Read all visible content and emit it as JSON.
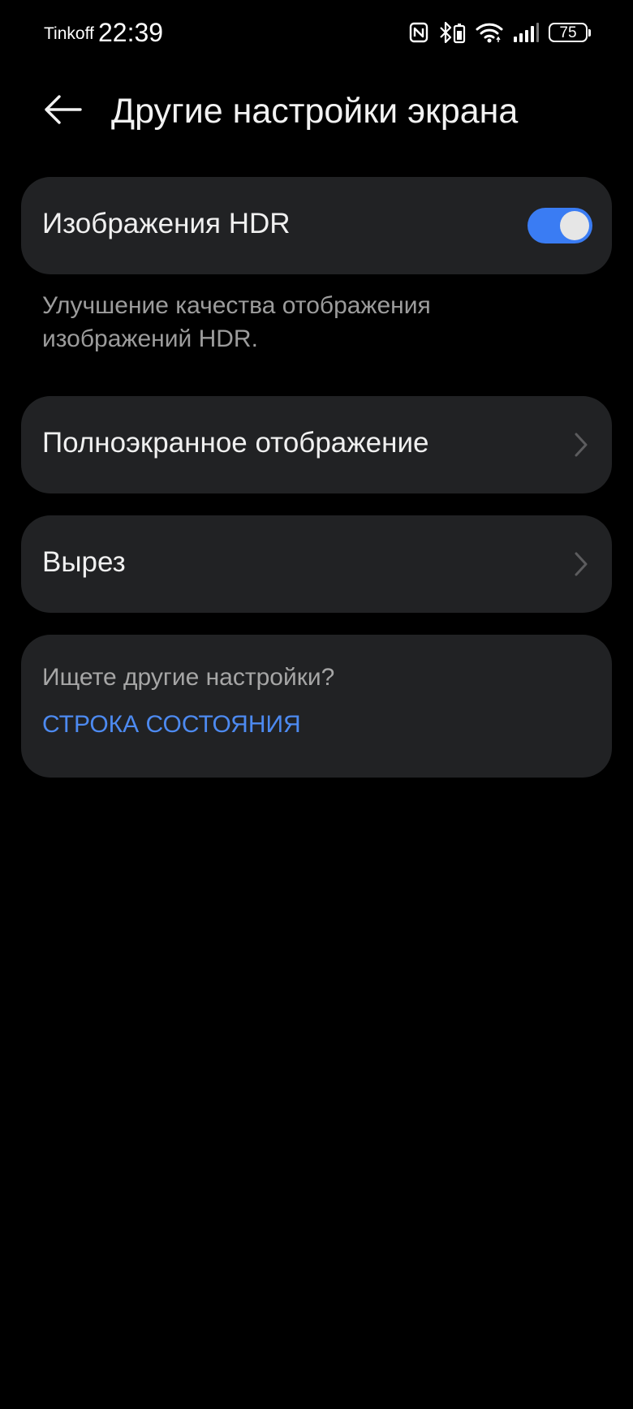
{
  "status_bar": {
    "carrier": "Tinkoff",
    "time": "22:39",
    "battery_level": "75",
    "icons": [
      "nfc-icon",
      "bluetooth-battery-icon",
      "wifi-icon",
      "signal-icon",
      "battery-icon"
    ]
  },
  "header": {
    "back_icon": "arrow-left-icon",
    "title": "Другие настройки экрана"
  },
  "hdr_setting": {
    "label": "Изображения HDR",
    "enabled": true,
    "description": "Улучшение качества отображения изображений HDR."
  },
  "menu_items": [
    {
      "label": "Полноэкранное отображение",
      "icon": "chevron-right-icon"
    },
    {
      "label": "Вырез",
      "icon": "chevron-right-icon"
    }
  ],
  "other_settings": {
    "question": "Ищете другие настройки?",
    "link_label": "СТРОКА СОСТОЯНИЯ"
  },
  "colors": {
    "background": "#000000",
    "card": "#212224",
    "accent": "#3a7cf3",
    "link": "#4d8af0",
    "secondary_text": "#9c9c9c"
  }
}
